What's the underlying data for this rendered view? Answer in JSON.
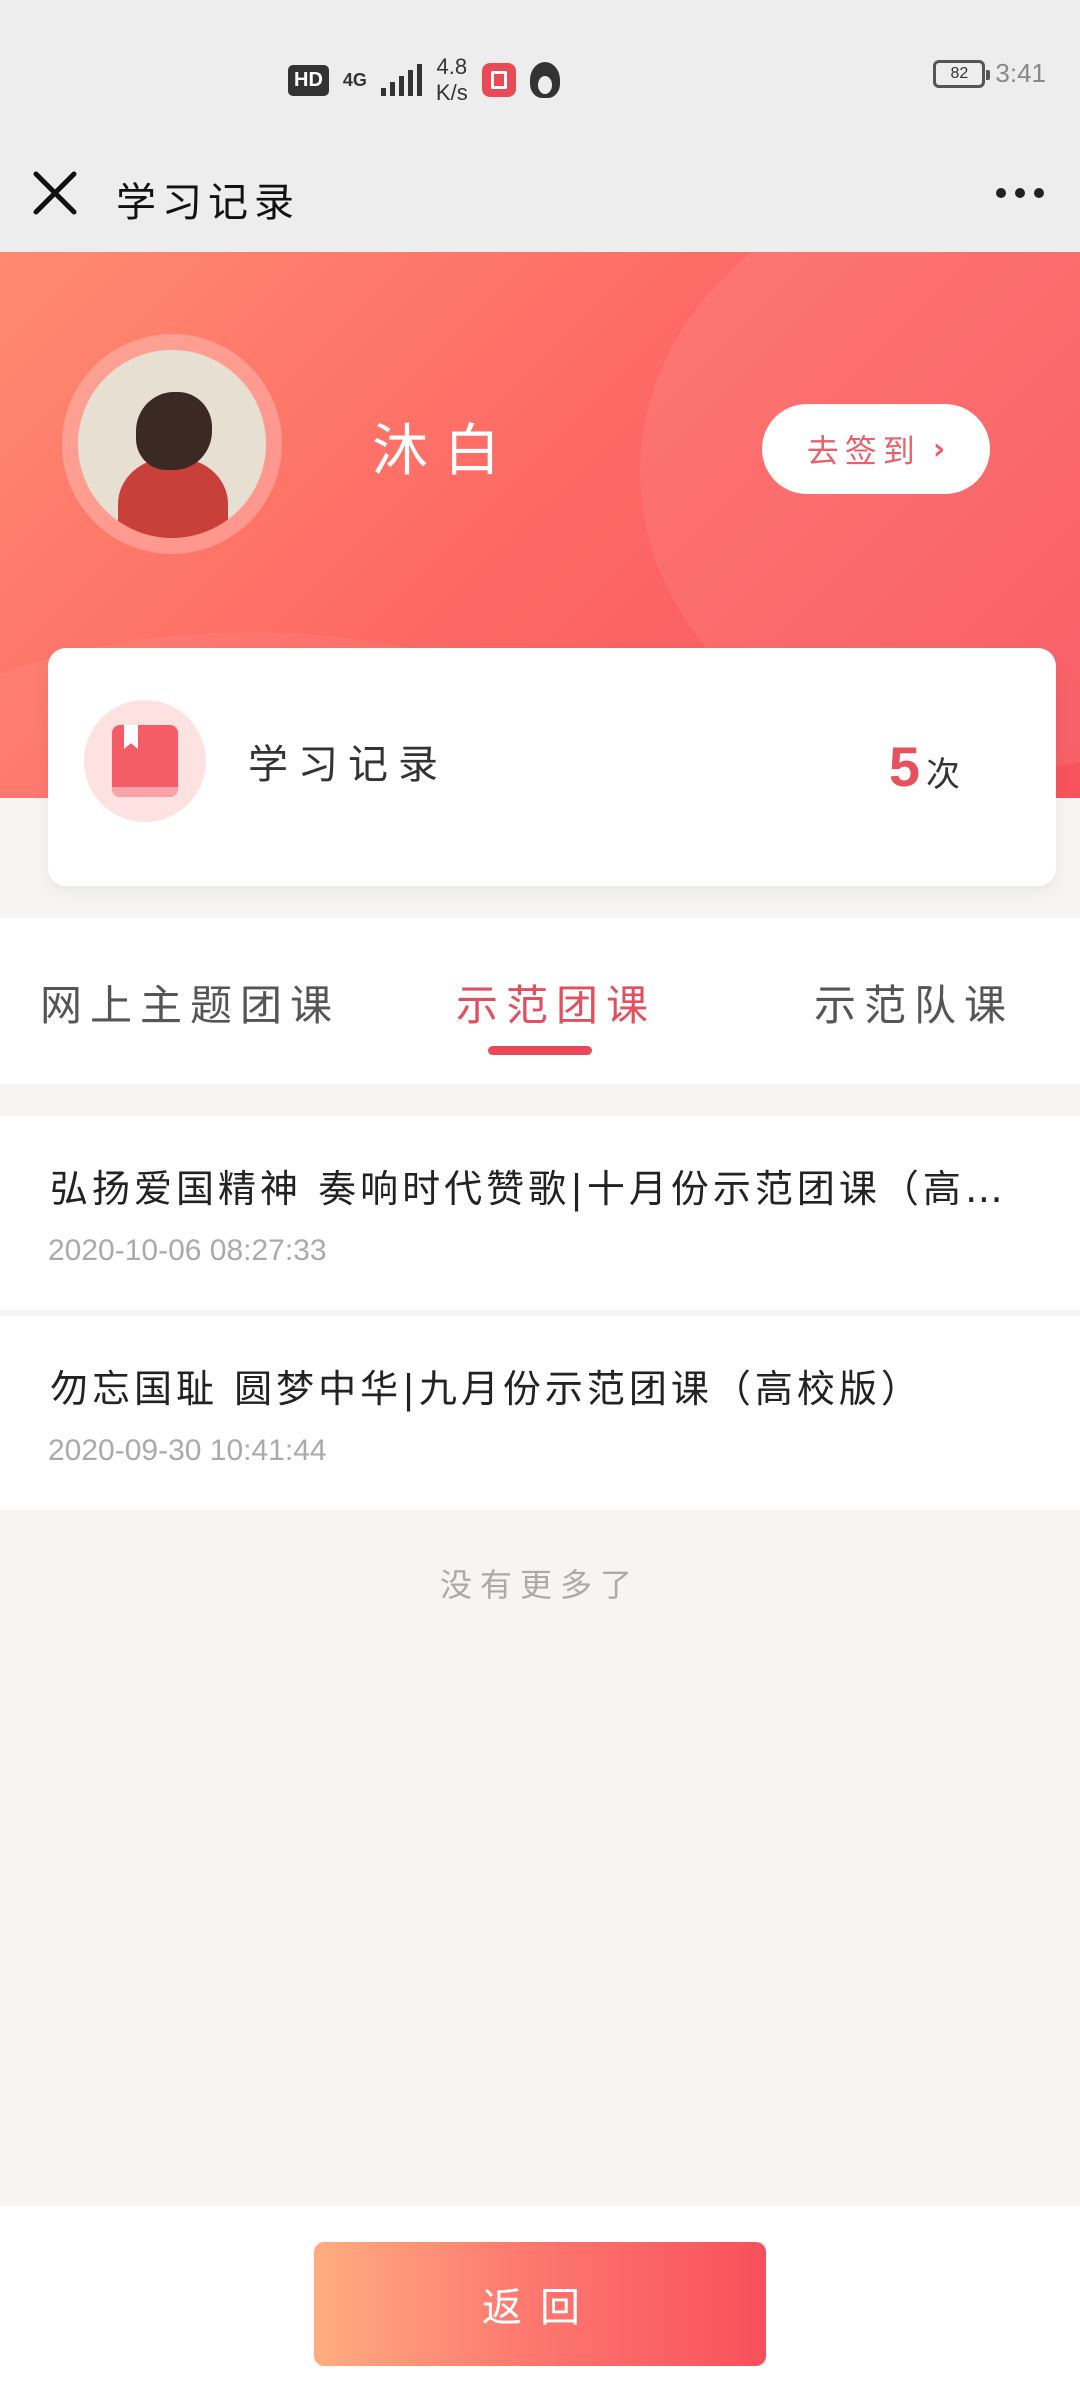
{
  "status_bar": {
    "hd": "HD",
    "network": "4G",
    "speed_value": "4.8",
    "speed_unit": "K/s",
    "battery": "82",
    "time": "3:41"
  },
  "nav": {
    "title": "学习记录",
    "close_icon": "close-icon",
    "more_icon": "more-icon"
  },
  "profile": {
    "name": "沐白",
    "checkin_label": "去签到",
    "checkin_chevron": "›"
  },
  "record": {
    "label": "学习记录",
    "count": "5",
    "unit": "次"
  },
  "tabs": [
    {
      "label": "网上主题团课"
    },
    {
      "label": "示范团课"
    },
    {
      "label": "示范队课"
    }
  ],
  "active_tab": 1,
  "courses": [
    {
      "title": "弘扬爱国精神 奏响时代赞歌|十月份示范团课（高校版）",
      "date": "2020-10-06 08:27:33"
    },
    {
      "title": "勿忘国耻 圆梦中华|九月份示范团课（高校版）",
      "date": "2020-09-30 10:41:44"
    }
  ],
  "no_more": "没有更多了",
  "footer": {
    "back_label": "返回"
  },
  "colors": {
    "accent": "#e84a5b",
    "hero_start": "#ff8a70",
    "hero_end": "#f8535d"
  }
}
